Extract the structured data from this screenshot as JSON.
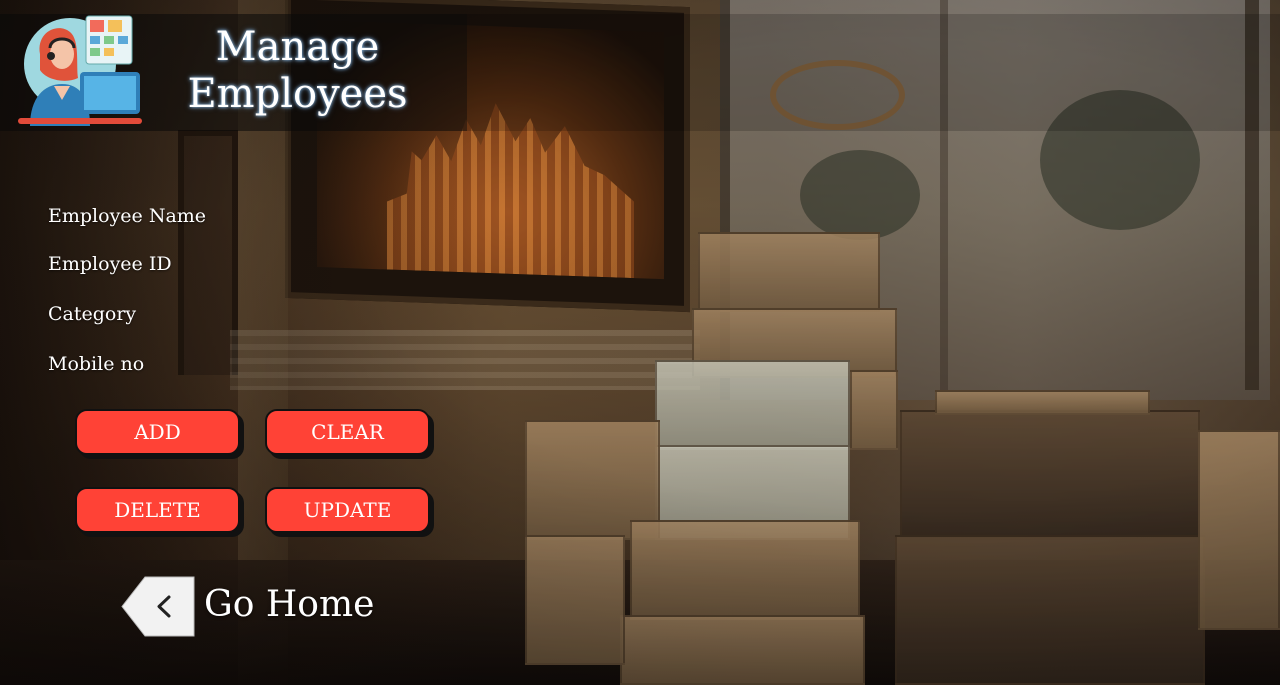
{
  "header": {
    "title_line1": "Manage",
    "title_line2": "Employees",
    "logo_icon": "receptionist-at-computer-icon"
  },
  "form": {
    "labels": [
      "Employee Name",
      "Employee ID",
      "Category",
      "Mobile no"
    ]
  },
  "buttons": {
    "add": "ADD",
    "clear": "CLEAR",
    "delete": "DELETE",
    "update": "UPDATE"
  },
  "navigation": {
    "go_home": "Go Home",
    "back_icon": "chevron-left-icon"
  },
  "colors": {
    "button_fill": "#ff4236",
    "button_border": "#111111",
    "text": "#ffffff"
  }
}
